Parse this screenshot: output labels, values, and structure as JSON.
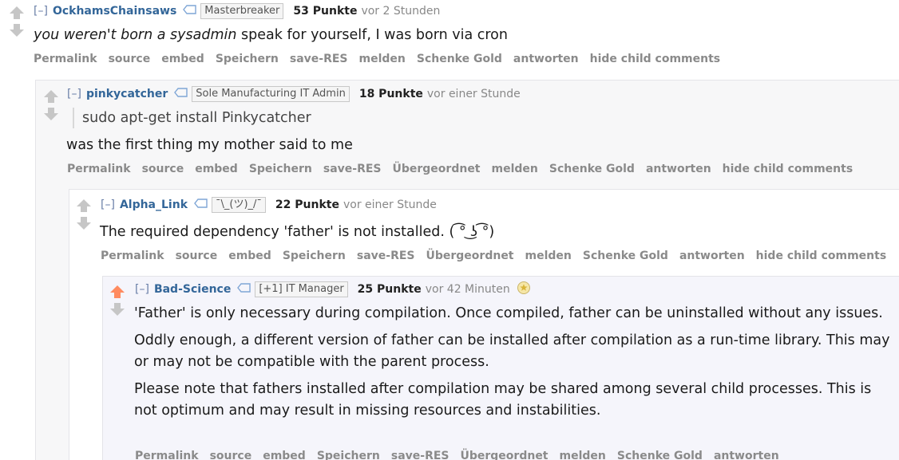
{
  "comments": [
    {
      "expand": "[–]",
      "author": "OckhamsChainsaws",
      "flair": "Masterbreaker",
      "points": "53 Punkte",
      "time": "vor 2 Stunden",
      "body": {
        "italic": "you weren't born a sysadmin",
        "rest": " speak for yourself, I was born via cron"
      },
      "buttons": [
        "Permalink",
        "source",
        "embed",
        "Speichern",
        "save-RES",
        "melden",
        "Schenke Gold",
        "antworten",
        "hide child comments"
      ]
    },
    {
      "expand": "[–]",
      "author": "pinkycatcher",
      "flair": "Sole Manufacturing IT Admin",
      "points": "18 Punkte",
      "time": "vor einer Stunde",
      "quote": "sudo apt-get install Pinkycatcher",
      "body": "was the first thing my mother said to me",
      "buttons": [
        "Permalink",
        "source",
        "embed",
        "Speichern",
        "save-RES",
        "Übergeordnet",
        "melden",
        "Schenke Gold",
        "antworten",
        "hide child comments"
      ]
    },
    {
      "expand": "[–]",
      "author": "Alpha_Link",
      "flair": "¯\\_(ツ)_/¯",
      "points": "22 Punkte",
      "time": "vor einer Stunde",
      "body": "The required dependency 'father' is not installed. ( ͡° ͜ʖ ͡°)",
      "buttons": [
        "Permalink",
        "source",
        "embed",
        "Speichern",
        "save-RES",
        "Übergeordnet",
        "melden",
        "Schenke Gold",
        "antworten",
        "hide child comments"
      ]
    },
    {
      "expand": "[–]",
      "author": "Bad-Science",
      "flair": "[+1] IT Manager",
      "points": "25 Punkte",
      "time": "vor 42 Minuten",
      "upvoted": true,
      "paragraphs": [
        "'Father' is only necessary during compilation. Once compiled, father can be uninstalled without any issues.",
        "Oddly enough, a different version of father can be installed after compilation as a run-time library. This may or may not be compatible with the parent process.",
        "Please note that fathers installed after compilation may be shared among several child processes. This is not optimum and may result in missing resources and instabilities."
      ],
      "buttons": [
        "Permalink",
        "source",
        "embed",
        "Speichern",
        "save-RES",
        "Übergeordnet",
        "melden",
        "Schenke Gold",
        "antworten"
      ]
    }
  ],
  "colors": {
    "author": "#336699",
    "upvote_active": "#ff8b60",
    "arrow_neutral": "#c6c6c6"
  },
  "icons": [
    "upvote-arrow-icon",
    "downvote-arrow-icon",
    "flair-tag-icon",
    "gold-award-icon"
  ]
}
